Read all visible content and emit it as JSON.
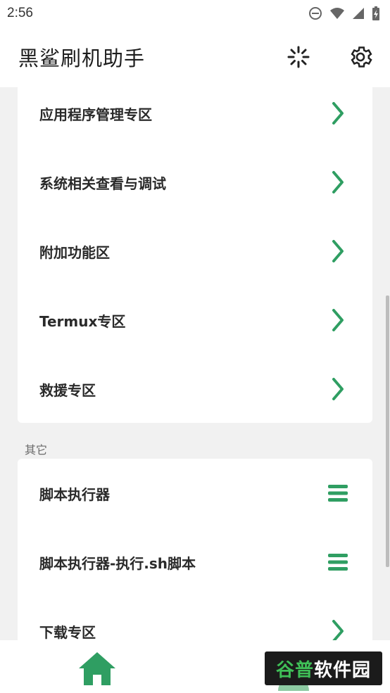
{
  "status_bar": {
    "time": "2:56"
  },
  "app_bar": {
    "title": "黑鲨刷机助手",
    "loading_icon": "spinner-icon",
    "settings_icon": "gear-icon"
  },
  "colors": {
    "accent": "#2f9e62",
    "background": "#f1f1f1",
    "card": "#ffffff"
  },
  "group1": {
    "items": [
      {
        "label": "应用程序管理专区",
        "icon": "chevron-right-icon"
      },
      {
        "label": "系统相关查看与调试",
        "icon": "chevron-right-icon"
      },
      {
        "label": "附加功能区",
        "icon": "chevron-right-icon"
      },
      {
        "label": "Termux专区",
        "icon": "chevron-right-icon"
      },
      {
        "label": "救援专区",
        "icon": "chevron-right-icon"
      }
    ]
  },
  "group2": {
    "header": "其它",
    "items": [
      {
        "label": "脚本执行器",
        "icon": "menu-icon"
      },
      {
        "label": "脚本执行器-执行.sh脚本",
        "icon": "menu-icon"
      },
      {
        "label": "下载专区",
        "icon": "chevron-right-icon"
      }
    ]
  },
  "bottom_nav": {
    "home_icon": "home-icon",
    "watermark_part1": "谷普",
    "watermark_part2": "软件园"
  }
}
